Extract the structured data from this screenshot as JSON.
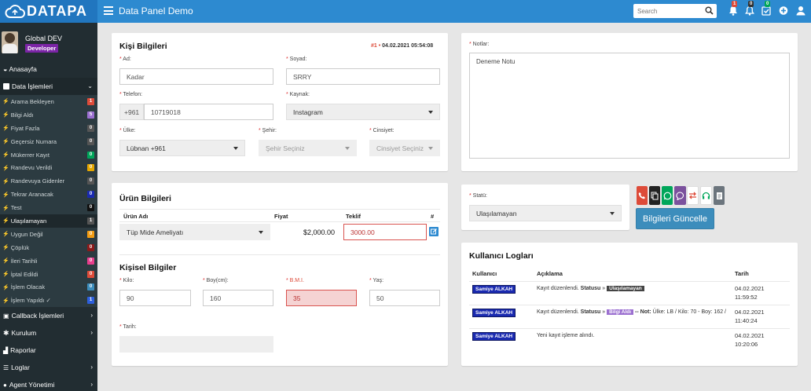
{
  "app": {
    "logo": "DATAPA",
    "title": "Data Panel Demo"
  },
  "search": {
    "placeholder": "Search"
  },
  "notifications": [
    {
      "icon": "bell-icon",
      "badge": "1",
      "color": "#dd4b39"
    },
    {
      "icon": "bell-outline-icon",
      "badge": "0",
      "color": "#333"
    },
    {
      "icon": "check-square-icon",
      "badge": "0",
      "color": "#00a65a"
    },
    {
      "icon": "plus-circle-icon",
      "badge": "",
      "color": ""
    },
    {
      "icon": "user-icon",
      "badge": "",
      "color": ""
    }
  ],
  "user": {
    "name": "Global DEV",
    "role": "Developer"
  },
  "sidebar": {
    "home": "Anasayfa",
    "data_ops": "Data İşlemleri",
    "sub_items": [
      {
        "label": "Arama Bekleyen",
        "count": "1",
        "color": "#dd4b39"
      },
      {
        "label": "Bilgi Aldı",
        "count": "5",
        "color": "#9b6fd0"
      },
      {
        "label": "Fiyat Fazla",
        "count": "0",
        "color": "#555"
      },
      {
        "label": "Geçersiz Numara",
        "count": "0",
        "color": "#555"
      },
      {
        "label": "Mükerrer Kayıt",
        "count": "0",
        "color": "#00a65a"
      },
      {
        "label": "Randevu Verildi",
        "count": "0",
        "color": "#e6a700"
      },
      {
        "label": "Randevuya Gidenler",
        "count": "0",
        "color": "#555"
      },
      {
        "label": "Tekrar Aranacak",
        "count": "0",
        "color": "#1a2ab0"
      },
      {
        "label": "Test",
        "count": "0",
        "color": "#111"
      },
      {
        "label": "Ulaşılamayan",
        "count": "1",
        "color": "#555"
      },
      {
        "label": "Uygun Değil",
        "count": "0",
        "color": "#f39c12"
      },
      {
        "label": "Çöplük",
        "count": "0",
        "color": "#8b1a1a"
      },
      {
        "label": "İleri Tarihli",
        "count": "0",
        "color": "#e83e8c"
      },
      {
        "label": "İptal Edildi",
        "count": "0",
        "color": "#dd4b39"
      },
      {
        "label": "İşlem Olacak",
        "count": "0",
        "color": "#3c8dbc"
      },
      {
        "label": "İşlem Yapıldı ✓",
        "count": "1",
        "color": "#2d5fdc"
      }
    ],
    "callback": "Callback İşlemleri",
    "kurulum": "Kurulum",
    "raporlar": "Raporlar",
    "loglar": "Loglar",
    "agent": "Agent Yönetimi"
  },
  "person": {
    "title": "Kişi Bilgileri",
    "record_no": "#1",
    "record_date": "04.02.2021 05:54:08",
    "ad_label": "Ad:",
    "ad": "Kadar",
    "soyad_label": "Soyad:",
    "soyad": "SRRY",
    "telefon_label": "Telefon:",
    "phone_code": "+961",
    "telefon": "10719018",
    "kaynak_label": "Kaynak:",
    "kaynak": "Instagram",
    "ulke_label": "Ülke:",
    "ulke": "Lübnan +961",
    "sehir_label": "Şehir:",
    "sehir": "Şehir Seçiniz",
    "cinsiyet_label": "Cinsiyet:",
    "cinsiyet": "Cinsiyet Seçiniz"
  },
  "notes": {
    "label": "Notlar:",
    "text": "Deneme Notu"
  },
  "product": {
    "title": "Ürün Bilgileri",
    "col_name": "Ürün Adı",
    "col_price": "Fiyat",
    "col_offer": "Teklif",
    "col_hash": "#",
    "name": "Tüp Mide Ameliyatı",
    "price": "$2,000.00",
    "offer": "3000.00"
  },
  "personal": {
    "title": "Kişisel Bilgiler",
    "kilo_label": "Kilo:",
    "kilo": "90",
    "boy_label": "Boy(cm):",
    "boy": "160",
    "bmi_label": "B.M.I.",
    "bmi": "35",
    "yas_label": "Yaş:",
    "yas": "50",
    "tarih_label": "Tarih:"
  },
  "status": {
    "label": "Statü:",
    "value": "Ulaşılamayan",
    "update_button": "Bilgileri Güncelle"
  },
  "actions": [
    {
      "icon": "phone-icon",
      "color": "#dd4b39"
    },
    {
      "icon": "copy-icon",
      "color": "#222"
    },
    {
      "icon": "whatsapp-icon",
      "color": "#00a65a"
    },
    {
      "icon": "viber-icon",
      "color": "#7b519d"
    },
    {
      "icon": "transfer-icon",
      "color": "#dd4b39"
    },
    {
      "icon": "headset-icon",
      "color": "#00a65a"
    },
    {
      "icon": "document-icon",
      "color": "#666"
    }
  ],
  "logs": {
    "title": "Kullanıcı Logları",
    "col_user": "Kullanıcı",
    "col_desc": "Açıklama",
    "col_date": "Tarih",
    "rows": [
      {
        "user": "Samiye ALKAH",
        "desc_pre": "Kayıt düzenlendi.",
        "status_word": "Statusu",
        "arrow": "»",
        "tag": "Ulaşılamayan",
        "note_word": "",
        "note": "",
        "date": "04.02.2021",
        "time": "11:59:52"
      },
      {
        "user": "Samiye ALKAH",
        "desc_pre": "Kayıt düzenlendi.",
        "status_word": "Statusu",
        "arrow": "»",
        "tag": "Bilgi Aldı",
        "note_word": "-- Not:",
        "note": "Ülke: LB / Kilo: 70 - Boy: 162 /",
        "date": "04.02.2021",
        "time": "11:40:24"
      },
      {
        "user": "Samiye ALKAH",
        "desc_pre": "Yeni kayıt işleme alındı.",
        "status_word": "",
        "arrow": "",
        "tag": "",
        "note_word": "",
        "note": "",
        "date": "04.02.2021",
        "time": "10:20:06"
      }
    ]
  }
}
